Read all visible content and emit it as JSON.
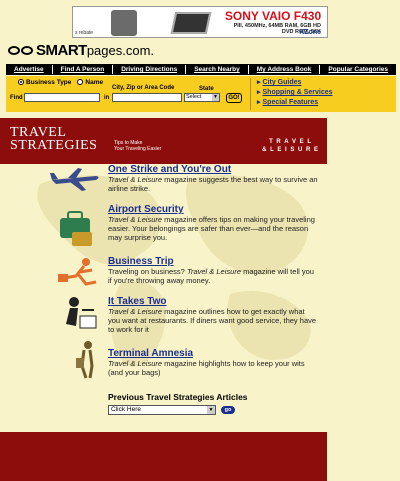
{
  "ad": {
    "brand": "SONY VAIO F430",
    "spec_line1": "PIII, 450MHz, 64MB RAM, 6GB HD",
    "spec_line2": "DVD ROM, 56K",
    "zone": "KZone",
    "rebate": "s rebate"
  },
  "logo": {
    "smart": "SMART",
    "pages": "pages.com."
  },
  "nav": [
    "Advertise",
    "Find A Person",
    "Driving Directions",
    "Search Nearby",
    "My Address Book",
    "Popular Categories"
  ],
  "search": {
    "radio_business": "Business Type",
    "radio_name": "Name",
    "city_label": "City, Zip or Area Code",
    "state_label": "State",
    "find_label": "Find",
    "in_label": "in",
    "state_value": "Select",
    "go_label": "GO!",
    "links": [
      "City Guides",
      "Shopping & Services",
      "Special Features"
    ]
  },
  "header": {
    "title_line1": "TRAVEL",
    "title_line2": "STRATEGIES",
    "tagline_line1": "Tips to Make",
    "tagline_line2": "Your Traveling Easier",
    "brand_line1": "T R A V E L",
    "brand_line2": "& L E I S U R E"
  },
  "articles": [
    {
      "title": "One Strike and You're Out",
      "mag": "Travel & Leisure",
      "desc": " magazine suggests the best way to survive an airline strike."
    },
    {
      "title": "Airport Security",
      "mag": "Travel & Leisure",
      "desc": " magazine offers tips on making your traveling easier. Your belongings are safer than ever—and the reason may surprise you."
    },
    {
      "title": "Business Trip",
      "pre": "Traveling on business? ",
      "mag": "Travel & Leisure",
      "desc": " magazine will tell you if you're throwing away money."
    },
    {
      "title": "It Takes Two",
      "mag": "Travel & Leisure",
      "desc": " magazine outlines how to get exactly what you want at restaurants. If diners want good service, they have to work for it"
    },
    {
      "title": "Terminal Amnesia",
      "mag": "Travel & Leisure",
      "desc": " magazine highlights how to keep your wits (and your bags)"
    }
  ],
  "previous": {
    "heading": "Previous Travel Strategies Articles",
    "select_value": "Click Here",
    "go_label": "go"
  }
}
